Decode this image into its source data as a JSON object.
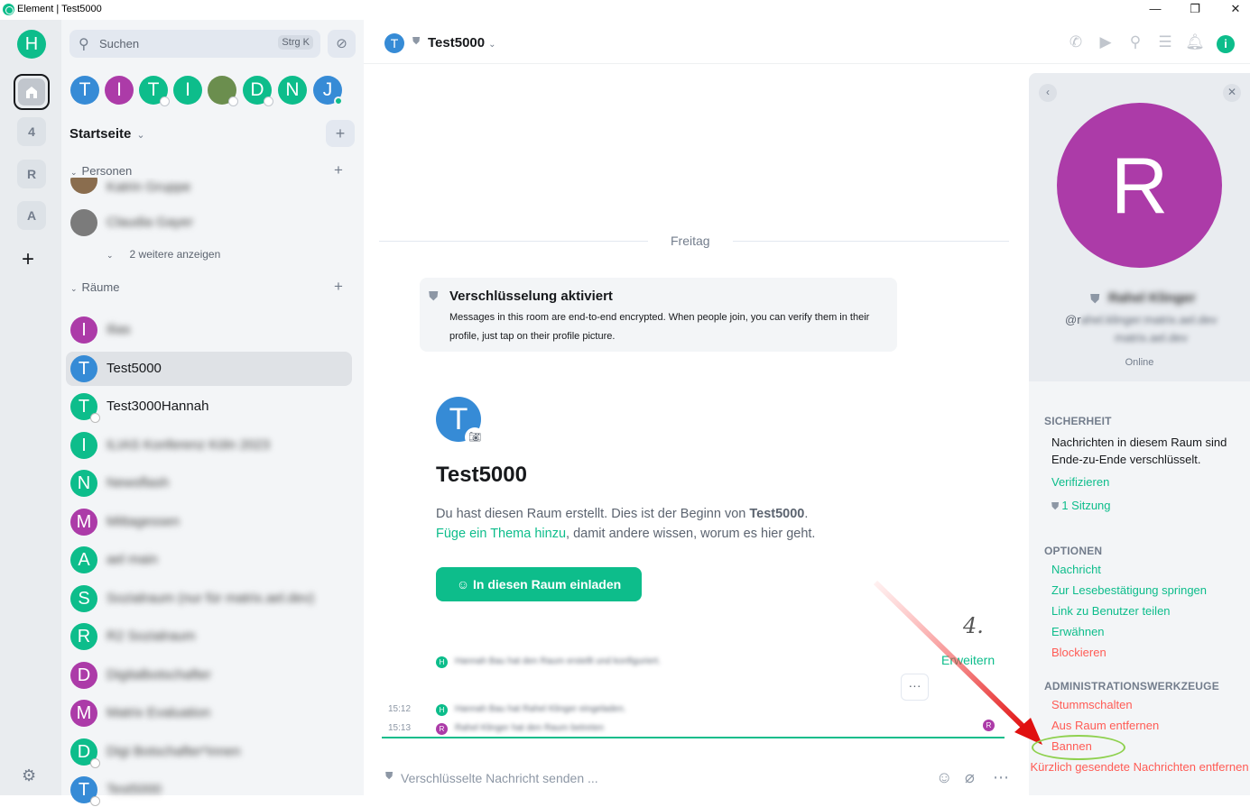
{
  "window": {
    "title": "Element | Test5000",
    "controls": {
      "minimize": "—",
      "maximize": "❐",
      "close": "✕"
    }
  },
  "spaces": {
    "user_initial": "H",
    "items": [
      {
        "label": "4"
      },
      {
        "label": "R"
      },
      {
        "label": "A"
      }
    ],
    "add": "+",
    "settings": "⚙"
  },
  "search": {
    "placeholder": "Suchen",
    "shortcut": "Strg K"
  },
  "recent_avatars": [
    {
      "initial": "T",
      "color": "#368bd6"
    },
    {
      "initial": "I",
      "color": "#ac3ba8"
    },
    {
      "initial": "T",
      "color": "#0dbd8b"
    },
    {
      "initial": "I",
      "color": "#0dbd8b"
    },
    {
      "initial": "",
      "color": "#6b8e4e"
    },
    {
      "initial": "D",
      "color": "#0dbd8b"
    },
    {
      "initial": "N",
      "color": "#0dbd8b"
    },
    {
      "initial": "J",
      "color": "#368bd6"
    }
  ],
  "home": {
    "title": "Startseite",
    "add": "+"
  },
  "people": {
    "header": "Personen",
    "items": [
      {
        "name": "Katrin Gruppe",
        "color": "#8a6d4e"
      },
      {
        "name": "Claudia Gayer",
        "color": "#7b7b7b"
      }
    ],
    "more": "2 weitere anzeigen"
  },
  "rooms": {
    "header": "Räume",
    "items": [
      {
        "initial": "I",
        "name": "Ilias",
        "color": "#ac3ba8",
        "blurred": true
      },
      {
        "initial": "T",
        "name": "Test5000",
        "color": "#368bd6",
        "blurred": false,
        "selected": true
      },
      {
        "initial": "T",
        "name": "Test3000Hannah",
        "color": "#0dbd8b",
        "blurred": false
      },
      {
        "initial": "I",
        "name": "ILIAS Konferenz Köln 2023",
        "color": "#0dbd8b",
        "blurred": true
      },
      {
        "initial": "N",
        "name": "Newsflash",
        "color": "#0dbd8b",
        "blurred": true
      },
      {
        "initial": "M",
        "name": "Mittagessen",
        "color": "#ac3ba8",
        "blurred": true
      },
      {
        "initial": "A",
        "name": "ael main",
        "color": "#0dbd8b",
        "blurred": true
      },
      {
        "initial": "S",
        "name": "Sozialraum (nur für matrix.ael.dev)",
        "color": "#0dbd8b",
        "blurred": true
      },
      {
        "initial": "R",
        "name": "R2 Sozialraum",
        "color": "#0dbd8b",
        "blurred": true
      },
      {
        "initial": "D",
        "name": "Digitalbotschafter",
        "color": "#ac3ba8",
        "blurred": true
      },
      {
        "initial": "M",
        "name": "Matrix Evaluation",
        "color": "#ac3ba8",
        "blurred": true
      },
      {
        "initial": "D",
        "name": "Digi Botschafter*innen",
        "color": "#0dbd8b",
        "blurred": true
      },
      {
        "initial": "T",
        "name": "Test5000",
        "color": "#368bd6",
        "blurred": true
      }
    ]
  },
  "room_header": {
    "avatar": "T",
    "name": "Test5000"
  },
  "timeline": {
    "day": "Freitag",
    "encryption": {
      "title": "Verschlüsselung aktiviert",
      "text": "Messages in this room are end-to-end encrypted. When people join, you can verify them in their profile, just tap on their profile picture."
    },
    "intro": {
      "avatar": "T",
      "title": "Test5000",
      "line1_pre": "Du hast diesen Raum erstellt. Dies ist der Beginn von ",
      "line1_room": "Test5000",
      "line1_post": ".",
      "topic_link": "Füge ein Thema hinzu",
      "line2_post": ", damit andere wissen, worum es hier geht.",
      "invite_button": "In diesen Raum einladen"
    },
    "events": [
      {
        "time": "",
        "initial": "H",
        "color": "#0dbd8b",
        "text": "Hannah Bau hat den Raum erstellt und konfiguriert."
      },
      {
        "time": "15:12",
        "initial": "H",
        "color": "#0dbd8b",
        "text": "Hannah Bau hat Rahel Klinger eingeladen."
      },
      {
        "time": "15:13",
        "initial": "R",
        "color": "#ac3ba8",
        "text": "Rahel Klinger hat den Raum betreten"
      }
    ],
    "expand": "Erweitern",
    "options": "···",
    "read_receipt": "R"
  },
  "composer": {
    "placeholder": "Verschlüsselte Nachricht senden ..."
  },
  "annotation": {
    "step": "4."
  },
  "right_panel": {
    "avatar": "R",
    "display_name": "Rahel Klinger",
    "mxid_prefix": "@r",
    "mxid_rest": "ahel.klinger:matrix.ael.dev",
    "mxid_line2": "matrix.ael.dev",
    "presence": "Online",
    "security": {
      "header": "SICHERHEIT",
      "text": "Nachrichten in diesem Raum sind Ende-zu-Ende verschlüsselt.",
      "verify": "Verifizieren",
      "sessions": "1 Sitzung"
    },
    "options": {
      "header": "OPTIONEN",
      "items": [
        "Nachricht",
        "Zur Lesebestätigung springen",
        "Link zu Benutzer teilen",
        "Erwähnen"
      ],
      "block": "Blockieren"
    },
    "admin": {
      "header": "ADMINISTRATIONSWERKZEUGE",
      "items": [
        "Stummschalten",
        "Aus Raum entfernen",
        "Bannen",
        "Kürzlich gesendete Nachrichten entfernen"
      ]
    }
  }
}
